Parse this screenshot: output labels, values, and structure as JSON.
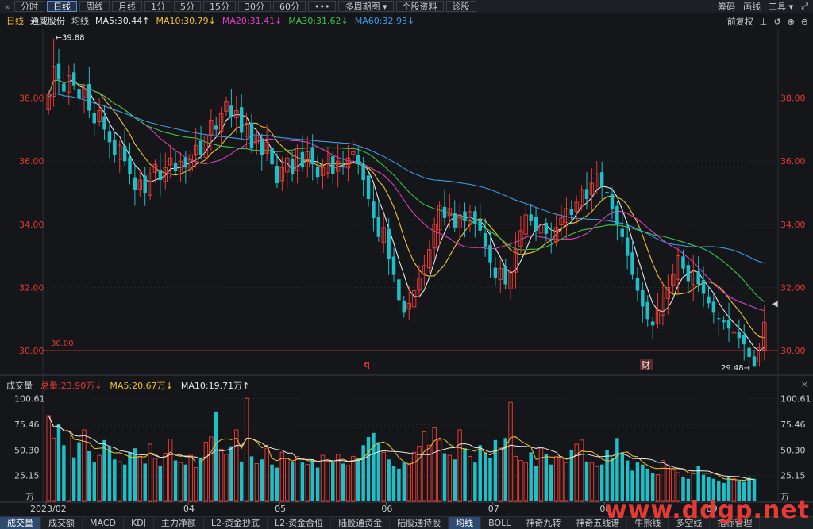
{
  "toolbar": {
    "back_icon": "«",
    "buttons": [
      "分时",
      "日线",
      "周线",
      "月线",
      "1分",
      "5分",
      "15分",
      "30分",
      "60分"
    ],
    "more": "•••",
    "multi_period": "多周期图 ▾",
    "profile": "个股资料",
    "diagnose": "诊股",
    "right": [
      "筹码",
      "画线",
      "工具 ▾"
    ],
    "expand_icon": "⤢"
  },
  "legend": {
    "period": "日线",
    "stock": "通威股份",
    "ma_label": "均线",
    "ma": [
      {
        "text": "MA5:30.44↑",
        "color": "#e8e8e8"
      },
      {
        "text": "MA10:30.79↓",
        "color": "#f2c230"
      },
      {
        "text": "MA20:31.41↓",
        "color": "#e040c0"
      },
      {
        "text": "MA30:31.62↓",
        "color": "#3ec24a"
      },
      {
        "text": "MA60:32.93↓",
        "color": "#3c9ae8"
      }
    ],
    "right": [
      "前复权",
      "⊥",
      "↺",
      "⊕",
      "⊖"
    ]
  },
  "price_axis": [
    "38.00",
    "36.00",
    "34.00",
    "32.00",
    "30.00"
  ],
  "annotations": {
    "high": "←39.88",
    "low": "29.48→",
    "support": "30.00",
    "marker_q": "q",
    "marker_cai": "财"
  },
  "volume": {
    "label": "成交量",
    "total": "总量:23.90万↓",
    "ma5": "MA5:20.67万↓",
    "ma10": "MA10:19.71万↑",
    "close_icon": "×",
    "axis": [
      "100.61",
      "75.46",
      "50.30",
      "25.15",
      "万"
    ]
  },
  "dates": [
    "2023/02",
    "04",
    "05",
    "06",
    "07",
    "08",
    "09"
  ],
  "bottom_tabs": [
    "成交量",
    "成交额",
    "MACD",
    "KDJ",
    "主力净额",
    "L2-资金抄底",
    "L2-资金合位",
    "陆股通资金",
    "陆股通持股",
    "均线",
    "BOLL",
    "神奇九转",
    "神奇五线谱",
    "牛熊线",
    "多空线",
    "指标管理"
  ],
  "watermark": "www.ddgp.net",
  "colors": {
    "up": "#e53935",
    "down": "#1fbfc8",
    "bg": "#141619",
    "grid": "#262a31"
  },
  "chart_data": {
    "type": "candlestick",
    "ylim": [
      29.3,
      40.2
    ],
    "closes": [
      38.1,
      39.0,
      38.6,
      38.2,
      38.7,
      38.4,
      38.0,
      38.3,
      37.6,
      37.2,
      37.6,
      37.0,
      36.6,
      36.2,
      36.5,
      36.0,
      35.6,
      35.1,
      35.4,
      35.0,
      35.6,
      35.9,
      35.4,
      35.8,
      36.1,
      35.7,
      36.0,
      35.8,
      36.2,
      36.5,
      36.2,
      36.8,
      37.3,
      37.0,
      37.5,
      37.9,
      37.4,
      37.6,
      36.9,
      37.2,
      36.4,
      36.8,
      36.2,
      36.6,
      35.9,
      35.3,
      35.8,
      36.1,
      35.6,
      36.4,
      35.8,
      36.3,
      35.9,
      35.5,
      35.8,
      36.2,
      35.6,
      36.0,
      35.8,
      36.1,
      36.3,
      35.9,
      35.4,
      34.8,
      34.2,
      33.6,
      33.9,
      32.9,
      32.4,
      31.6,
      31.2,
      31.5,
      31.9,
      32.3,
      32.7,
      33.2,
      34.0,
      34.6,
      34.2,
      34.5,
      33.9,
      34.3,
      34.1,
      34.4,
      34.0,
      33.8,
      33.3,
      32.8,
      32.3,
      32.6,
      32.1,
      32.5,
      33.2,
      33.8,
      34.3,
      34.1,
      33.8,
      34.0,
      33.7,
      33.5,
      33.9,
      34.2,
      34.5,
      34.3,
      34.7,
      35.1,
      34.8,
      35.3,
      35.6,
      35.2,
      35.0,
      34.5,
      34.0,
      33.6,
      33.0,
      32.4,
      31.9,
      31.4,
      31.0,
      30.8,
      31.3,
      31.7,
      32.0,
      32.4,
      33.0,
      32.6,
      32.2,
      32.5,
      32.1,
      31.8,
      31.5,
      31.2,
      31.0,
      30.9,
      30.7,
      30.6,
      30.4,
      30.2,
      29.8,
      29.5,
      30.1,
      30.9
    ],
    "volumes": [
      84,
      62,
      76,
      55,
      68,
      43,
      58,
      70,
      49,
      38,
      45,
      60,
      53,
      41,
      39,
      36,
      48,
      52,
      44,
      37,
      56,
      42,
      35,
      47,
      61,
      40,
      38,
      36,
      45,
      33,
      42,
      58,
      63,
      88,
      51,
      46,
      54,
      70,
      39,
      101,
      44,
      37,
      41,
      52,
      36,
      33,
      48,
      42,
      39,
      44,
      38,
      36,
      41,
      33,
      45,
      40,
      38,
      46,
      37,
      35,
      44,
      42,
      55,
      63,
      67,
      58,
      48,
      41,
      35,
      32,
      38,
      36,
      48,
      54,
      68,
      55,
      72,
      60,
      47,
      45,
      41,
      70,
      52,
      44,
      38,
      55,
      48,
      42,
      60,
      53,
      62,
      97,
      44,
      40,
      38,
      48,
      35,
      52,
      46,
      36,
      44,
      42,
      38,
      50,
      56,
      60,
      39,
      38,
      34,
      36,
      50,
      42,
      62,
      48,
      40,
      30,
      38,
      36,
      32,
      28,
      26,
      40,
      35,
      31,
      28,
      24,
      22,
      30,
      35,
      26,
      24,
      22,
      20,
      18,
      24,
      22,
      20,
      19,
      23,
      22
    ]
  }
}
